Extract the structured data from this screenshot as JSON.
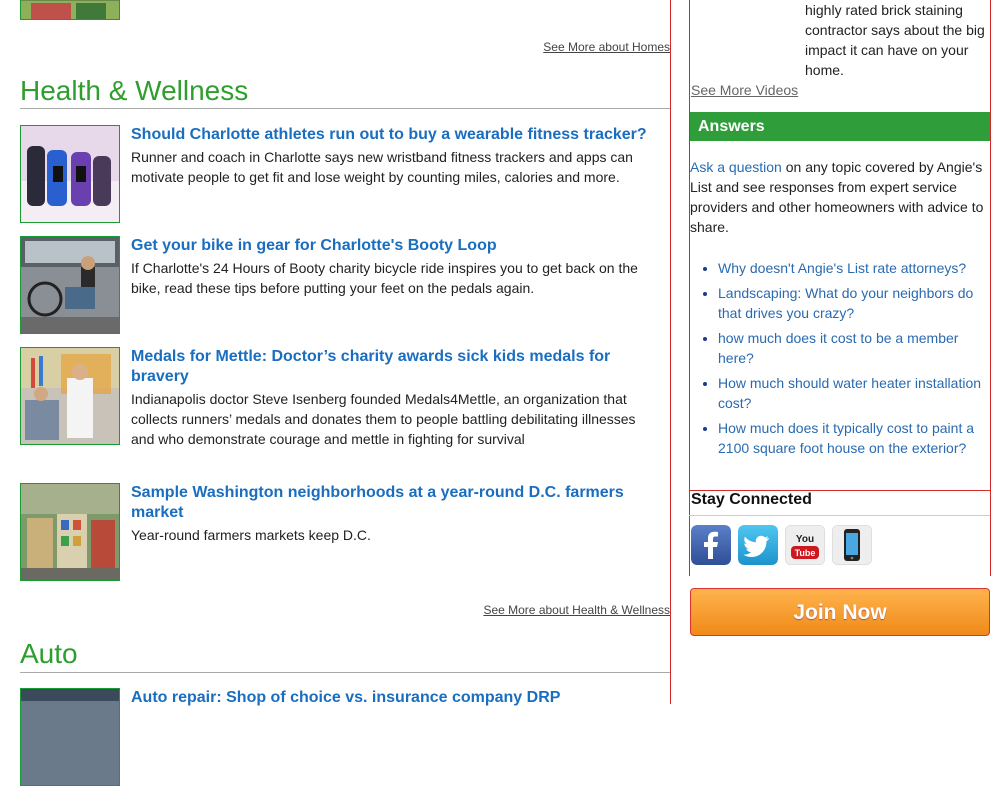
{
  "homes": {
    "see_more": "See More about Homes"
  },
  "health": {
    "title": "Health & Wellness",
    "see_more": "See More about Health & Wellness",
    "articles": [
      {
        "title": "Should Charlotte athletes run out to buy a wearable fitness tracker?",
        "body": "Runner and coach in Charlotte says new wristband fitness trackers and apps can motivate people to get fit and lose weight by counting miles, calories and more."
      },
      {
        "title": "Get your bike in gear for Charlotte's Booty Loop",
        "body": "If Charlotte's 24 Hours of Booty charity bicycle ride inspires you to get back on the bike, read these tips before putting your feet on the pedals again."
      },
      {
        "title": "Medals for Mettle: Doctor’s charity awards sick kids medals for bravery",
        "body": "Indianapolis doctor Steve Isenberg founded Medals4Mettle, an organization that collects runners’ medals and donates them to people battling debilitating illnesses and who demonstrate courage and mettle in fighting for survival"
      },
      {
        "title": "Sample Washington neighborhoods at a year-round D.C. farmers market",
        "body": "Year-round farmers markets keep D.C."
      }
    ]
  },
  "auto": {
    "title": "Auto",
    "articles": [
      {
        "title": "Auto repair: Shop of choice vs. insurance company DRP"
      }
    ]
  },
  "videos": {
    "text": "highly rated brick staining contractor says about the big impact it can have on your home.",
    "see_more": "See More Videos"
  },
  "answers": {
    "heading": "Answers",
    "ask_link": "Ask a question",
    "intro_rest": " on any topic covered by Angie's List and see responses from expert service providers and other homeowners with advice to share.",
    "questions": [
      "Why doesn't Angie's List rate attorneys?",
      "Landscaping: What do your neighbors do that drives you crazy?",
      "how much does it cost to be a member here?",
      "How much should water heater installation cost?",
      "How much does it typically cost to paint a 2100 square foot house on the exterior?"
    ]
  },
  "stay_connected": {
    "title": "Stay Connected",
    "icons": [
      "facebook-icon",
      "twitter-icon",
      "youtube-icon",
      "mobile-app-icon"
    ],
    "youtube_label": "You Tube"
  },
  "join": {
    "label": "Join Now"
  },
  "colors": {
    "accent_green": "#2f9e3a",
    "link_blue": "#1a6ec0",
    "border_red": "#d32a2a",
    "join_orange": "#f59a2a"
  }
}
